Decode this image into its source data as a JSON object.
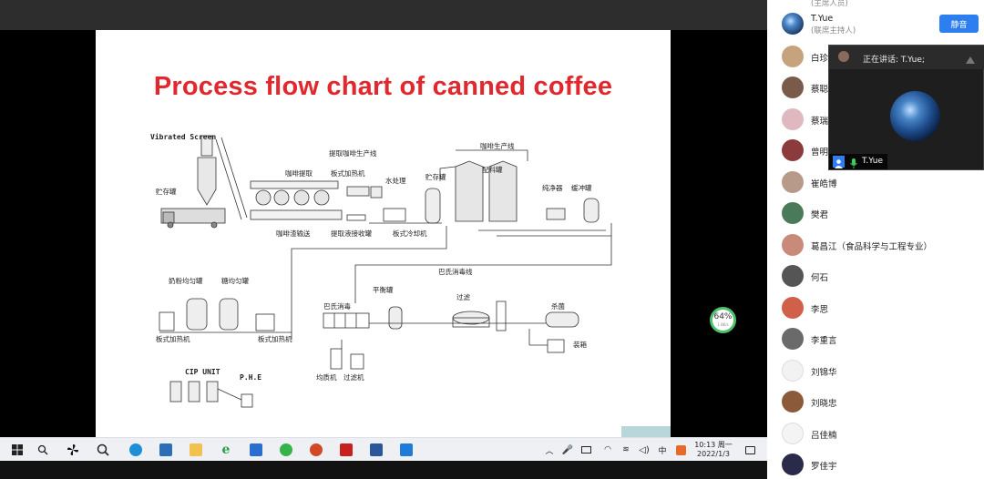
{
  "slide": {
    "title": "Process flow chart of canned coffee",
    "labels": {
      "vibrated_screen": "Vibrated Screen",
      "storage_bin": "贮存罐",
      "extraction_line": "提取咖啡生产线",
      "coffee_extraction": "咖啡提取",
      "plate_heater_top": "板式加热机",
      "water_treatment": "水处理",
      "storage_tank": "贮存罐",
      "coffee_line": "咖啡生产线",
      "batching_tank": "配料罐",
      "purifier": "纯净器",
      "buffer_tank": "缓冲罐",
      "residue_conveyor": "咖啡渣输送",
      "extract_collection": "提取液接收罐",
      "plate_cooler": "板式冷却机",
      "milk_tank": "奶粉均匀罐",
      "sugar_tank": "糖均匀罐",
      "pasteur_line": "巴氏消毒线",
      "pasteurizer": "巴氏消毒",
      "balance_tank": "平衡罐",
      "filter_top": "过滤",
      "sterilize": "杀菌",
      "plate_heater_left": "板式加热机",
      "plate_heater_right": "板式加热机",
      "packing": "装箱",
      "homogenizer": "均质机",
      "filter_machine": "过滤机",
      "cip_unit": "CIP UNIT",
      "phe": "P.H.E"
    }
  },
  "speed_badge": {
    "percent": "64",
    "unit": "%",
    "rate": "1.8K/s"
  },
  "taskbar": {
    "time": "10:13 周一",
    "date": "2022/1/3",
    "icons": [
      "windows-start-icon",
      "search-icon",
      "pinwheel-icon",
      "zoom-icon",
      "edge-icon",
      "store-icon",
      "explorer-icon",
      "ie-icon",
      "mail-icon",
      "wechat-icon",
      "powerpoint-icon",
      "acrobat-icon",
      "word-icon",
      "meeting-icon"
    ],
    "tray_icons": [
      "chevron-up-icon",
      "mic-icon",
      "screen-icon",
      "wifi-icon",
      "volume-icon",
      "input-icon",
      "notification-icon"
    ]
  },
  "participants": [
    {
      "name": "T.Yue",
      "sub": "(联席主持人)",
      "avatar_color": "#3b6ea8",
      "has_mute": true
    },
    {
      "name": "白珍",
      "avatar_color": "#c6a37c"
    },
    {
      "name": "蔡聪",
      "avatar_color": "#7a5a4a"
    },
    {
      "name": "蔡瑞",
      "avatar_color": "#e0b8c0"
    },
    {
      "name": "曾明",
      "avatar_color": "#8b3b3b"
    },
    {
      "name": "崔皓博",
      "avatar_color": "#b89a8a"
    },
    {
      "name": "樊君",
      "avatar_color": "#4a7a5a"
    },
    {
      "name": "葛昌江（食品科学与工程专业）",
      "avatar_color": "#c98a7a"
    },
    {
      "name": "何石",
      "avatar_color": "#555555"
    },
    {
      "name": "李思",
      "avatar_color": "#d0604a"
    },
    {
      "name": "李重言",
      "avatar_color": "#6a6a6a"
    },
    {
      "name": "刘锦华",
      "avatar_color": "#f2f2f2"
    },
    {
      "name": "刘晓忠",
      "avatar_color": "#8a5a3a"
    },
    {
      "name": "吕佳楠",
      "avatar_color": "#f4f4f4"
    },
    {
      "name": "罗佳宇",
      "avatar_color": "#2a2a4a"
    }
  ],
  "top_partial_text": "(主席人员)",
  "mute_label": "静音",
  "speaker_window": {
    "speaking_label": "正在讲话: T.Yue;",
    "name": "T.Yue"
  }
}
